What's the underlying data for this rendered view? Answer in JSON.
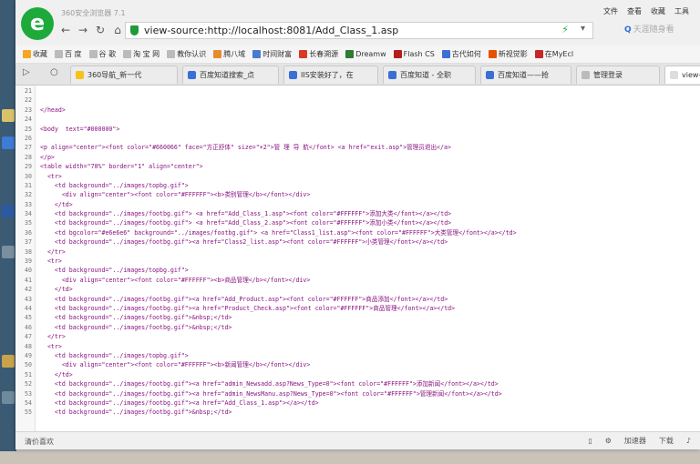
{
  "app": {
    "title": "360安全浏览器 7.1"
  },
  "menu": [
    "文件",
    "查看",
    "收藏",
    "工具"
  ],
  "address": {
    "url": "view-source:http://localhost:8081/Add_Class_1.asp"
  },
  "search": {
    "placeholder": "天涯随身看"
  },
  "bookmarks": [
    {
      "label": "收藏",
      "color": "#f5a623"
    },
    {
      "label": "百 度",
      "color": "#bbbbbb"
    },
    {
      "label": "谷 歌",
      "color": "#bbbbbb"
    },
    {
      "label": "淘 宝 网",
      "color": "#bbbbbb"
    },
    {
      "label": "教你认识",
      "color": "#bbbbbb"
    },
    {
      "label": "腾八域",
      "color": "#e88b2e"
    },
    {
      "label": "时间财富",
      "color": "#4a7bd1"
    },
    {
      "label": "长春溯源",
      "color": "#d83a2a"
    },
    {
      "label": "Dreamw",
      "color": "#2e7d32"
    },
    {
      "label": "Flash CS",
      "color": "#b71c1c"
    },
    {
      "label": "古代如何",
      "color": "#3b6fd6"
    },
    {
      "label": "新视觉影",
      "color": "#e65100"
    },
    {
      "label": "在MyEcl",
      "color": "#c62828"
    }
  ],
  "tabs": [
    {
      "label": "360导航_新一代",
      "color": "#f6c21b",
      "active": false
    },
    {
      "label": "百度知道搜索_点",
      "color": "#3b6fd6",
      "active": false
    },
    {
      "label": "IIS安装好了，在",
      "color": "#3b6fd6",
      "active": false
    },
    {
      "label": "百度知道 - 全职",
      "color": "#3b6fd6",
      "active": false
    },
    {
      "label": "百度知道——抢",
      "color": "#3b6fd6",
      "active": false
    },
    {
      "label": "管理登录",
      "color": "#bbbbbb",
      "active": false
    },
    {
      "label": "view-sou",
      "color": "#dddddd",
      "active": true
    }
  ],
  "source": {
    "lines": [
      {
        "no": "21",
        "text": ""
      },
      {
        "no": "22",
        "text": ""
      },
      {
        "no": "23",
        "text": "</head>"
      },
      {
        "no": "24",
        "text": ""
      },
      {
        "no": "25",
        "text": "<body  text=\"#000000\">"
      },
      {
        "no": "26",
        "text": ""
      },
      {
        "no": "27",
        "text": "<p align=\"center\"><font color=\"#660066\" face=\"方正舒体\" size=\"+2\">管 理 导 航</font> <a href=\"exit.asp\">管理员退出</a>"
      },
      {
        "no": "28",
        "text": "</p>"
      },
      {
        "no": "29",
        "text": "<table width=\"70%\" border=\"1\" align=\"center\">"
      },
      {
        "no": "30",
        "text": "  <tr>"
      },
      {
        "no": "31",
        "text": "    <td background=\"../images/topbg.gif\">"
      },
      {
        "no": "32",
        "text": "      <div align=\"center\"><font color=\"#FFFFFF\"><b>类别管理</b></font></div>"
      },
      {
        "no": "33",
        "text": "    </td>"
      },
      {
        "no": "34",
        "text": "    <td background=\"../images/footbg.gif\"> <a href=\"Add_Class_1.asp\"><font color=\"#FFFFFF\">添加大类</font></a></td>"
      },
      {
        "no": "35",
        "text": "    <td background=\"../images/footbg.gif\"> <a href=\"Add_Class_2.asp\"><font color=\"#FFFFFF\">添加小类</font></a></td>"
      },
      {
        "no": "36",
        "text": "    <td bgcolor=\"#e6e6e6\" background=\"../images/footbg.gif\"> <a href=\"Class1_list.asp\"><font color=\"#FFFFFF\">大类管理</font></a></td>"
      },
      {
        "no": "37",
        "text": "    <td background=\"../images/footbg.gif\"><a href=\"Class2_list.asp\"><font color=\"#FFFFFF\">小类管理</font></a></td>"
      },
      {
        "no": "38",
        "text": "  </tr>"
      },
      {
        "no": "39",
        "text": "  <tr>"
      },
      {
        "no": "40",
        "text": "    <td background=\"../images/topbg.gif\">"
      },
      {
        "no": "41",
        "text": "      <div align=\"center\"><font color=\"#FFFFFF\"><b>商品管理</b></font></div>"
      },
      {
        "no": "42",
        "text": "    </td>"
      },
      {
        "no": "43",
        "text": "    <td background=\"../images/footbg.gif\"><a href=\"Add_Product.asp\"><font color=\"#FFFFFF\">商品添加</font></a></td>"
      },
      {
        "no": "44",
        "text": "    <td background=\"../images/footbg.gif\"><a href=\"Product_Check.asp\"><font color=\"#FFFFFF\">商品管理</font></a></td>"
      },
      {
        "no": "45",
        "text": "    <td background=\"../images/footbg.gif\">&nbsp;</td>"
      },
      {
        "no": "46",
        "text": "    <td background=\"../images/footbg.gif\">&nbsp;</td>"
      },
      {
        "no": "47",
        "text": "  </tr>"
      },
      {
        "no": "48",
        "text": "  <tr>"
      },
      {
        "no": "49",
        "text": "    <td background=\"../images/topbg.gif\">"
      },
      {
        "no": "50",
        "text": "      <div align=\"center\"><font color=\"#FFFFFF\"><b>新闻管理</b></font></div>"
      },
      {
        "no": "51",
        "text": "    </td>"
      },
      {
        "no": "52",
        "text": "    <td background=\"../images/footbg.gif\"><a href=\"admin_Newsadd.asp?News_Type=0\"><font color=\"#FFFFFF\">添加新闻</font></a></td>"
      },
      {
        "no": "53",
        "text": "    <td background=\"../images/footbg.gif\"><a href=\"admin_NewsManu.asp?News_Type=0\"><font color=\"#FFFFFF\">管理新闻</font></a></td>"
      },
      {
        "no": "54",
        "text": "    <td background=\"../images/footbg.gif\"><a href=\"Add_Class_1.asp\"></a></td>"
      },
      {
        "no": "55",
        "text": "    <td background=\"../images/footbg.gif\">&nbsp;</td>"
      }
    ]
  },
  "status": {
    "left": "清价喜欢",
    "accelerator": "加速器",
    "download": "下载"
  }
}
